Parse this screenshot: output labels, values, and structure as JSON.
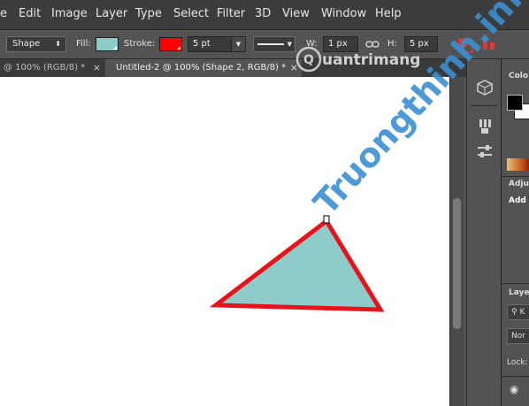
{
  "menu": {
    "items": [
      "e",
      "Edit",
      "Image",
      "Layer",
      "Type",
      "Select",
      "Filter",
      "3D",
      "View",
      "Window",
      "Help"
    ]
  },
  "options": {
    "tool_mode": "Shape",
    "fill_label": "Fill:",
    "fill_color": "#8ecccc",
    "stroke_label": "Stroke:",
    "stroke_color": "#ff0000",
    "stroke_width": "5 pt",
    "width_label": "W:",
    "width_value": "1 px",
    "height_label": "H:",
    "height_value": "5 px"
  },
  "tabs": [
    {
      "label": "@ 100% (RGB/8) *",
      "active": false
    },
    {
      "label": "Untitled-2 @ 100% (Shape 2, RGB/8) *",
      "active": true
    }
  ],
  "canvas": {
    "shape_fill": "#8ecccc",
    "shape_stroke": "#e8131a"
  },
  "watermark": {
    "text_top": "uantrimang",
    "text_diagonal": "Truongthinh.info",
    "color": "#3a8fd1"
  },
  "panels": {
    "color_title": "Colo",
    "adjust_title": "Adju",
    "adjust_add": "Add",
    "layers_title": "Laye",
    "layers_kind": "K",
    "layers_blend": "Nor",
    "layers_lock": "Lock:"
  }
}
